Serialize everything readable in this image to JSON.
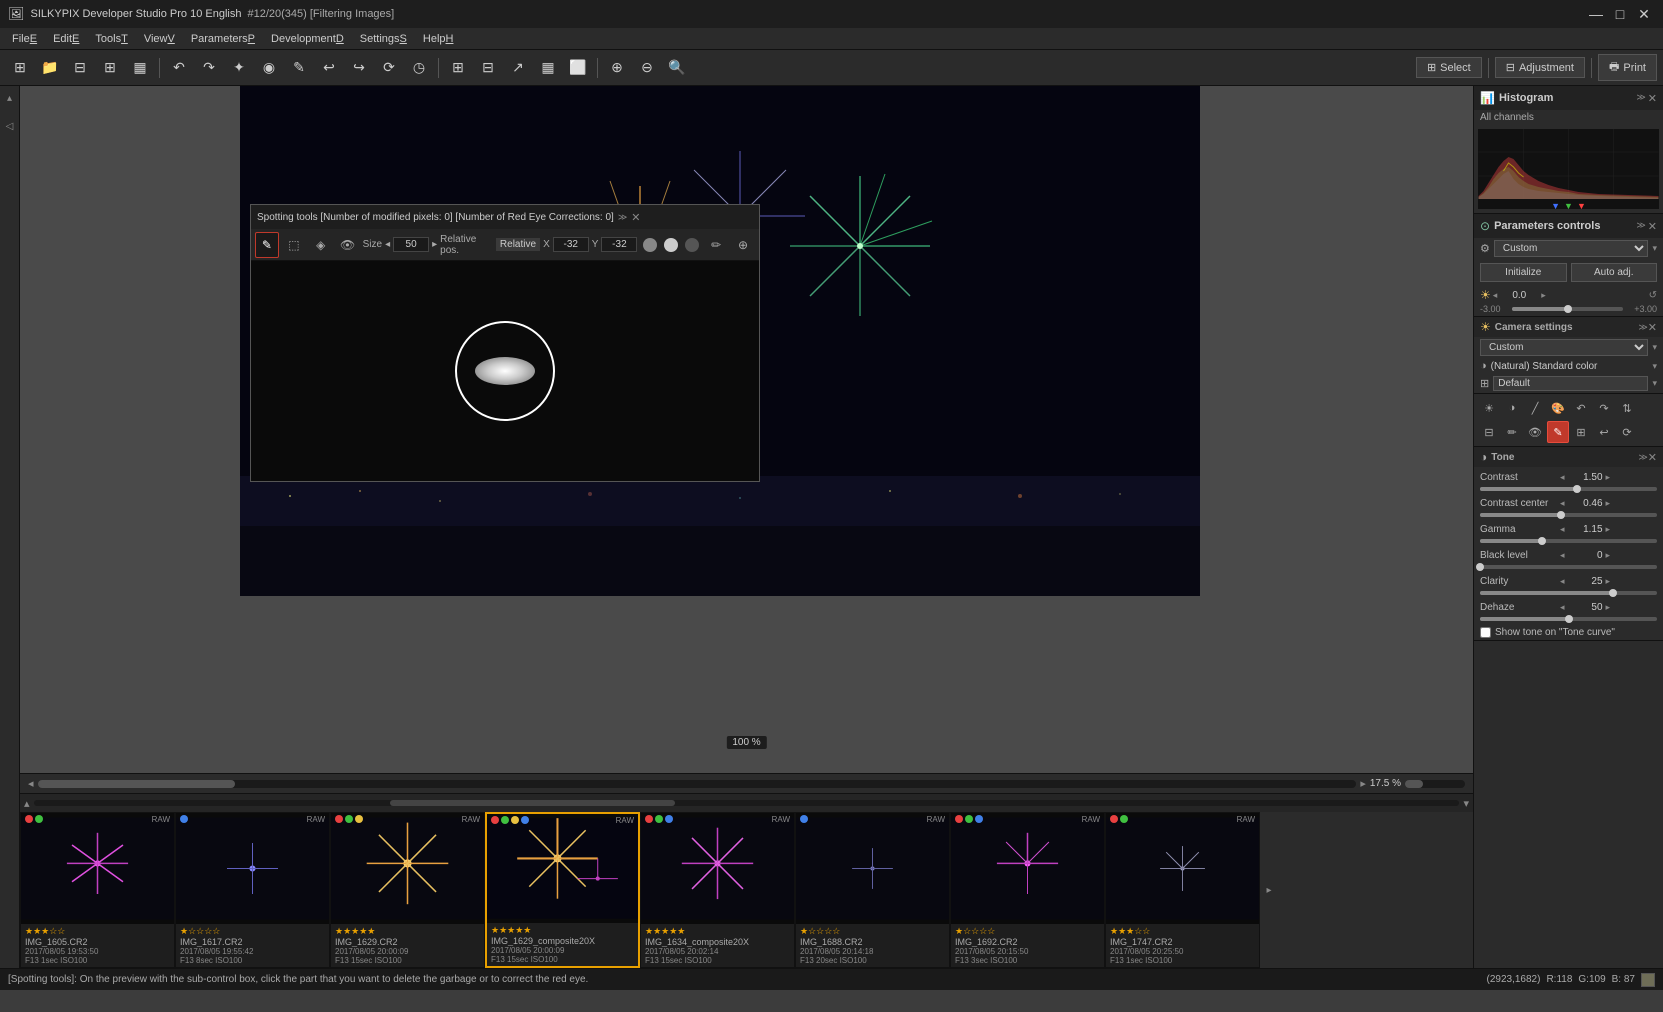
{
  "app": {
    "title": "SILKYPIX Developer Studio Pro 10 English",
    "subtitle": "#12/20(345) [Filtering Images]",
    "icon": "🖼"
  },
  "title_controls": {
    "minimize": "—",
    "maximize": "□",
    "close": "✕"
  },
  "menu": {
    "items": [
      {
        "label": "File(E)",
        "id": "file"
      },
      {
        "label": "Edit(E)",
        "id": "edit"
      },
      {
        "label": "Tools(T)",
        "id": "tools"
      },
      {
        "label": "View(V)",
        "id": "view"
      },
      {
        "label": "Parameters(P)",
        "id": "parameters"
      },
      {
        "label": "Development(D)",
        "id": "development"
      },
      {
        "label": "Settings(S)",
        "id": "settings"
      },
      {
        "label": "Help(H)",
        "id": "help"
      }
    ]
  },
  "toolbar": {
    "select_label": "Select",
    "select_icon": "⊞",
    "adjustment_label": "Adjustment",
    "adjustment_icon": "⊟",
    "print_label": "Print",
    "print_icon": "🖶"
  },
  "preview": {
    "zoom": "17.5",
    "zoom_unit": "%"
  },
  "spotting_tools": {
    "title": "Spotting tools [Number of modified pixels: 0] [Number of Red Eye Corrections: 0]",
    "size_label": "Size",
    "size_value": "50",
    "pos_label": "Relative pos.",
    "pos_type": "Relative",
    "x_label": "X",
    "x_value": "-32",
    "y_label": "Y",
    "y_value": "-32"
  },
  "histogram": {
    "title": "Histogram",
    "channel": "All channels"
  },
  "parameters_controls": {
    "title": "Parameters controls",
    "preset": "Custom",
    "initialize_label": "Initialize",
    "auto_adj_label": "Auto adj.",
    "value": "0.0",
    "range_min": "-3.00",
    "range_max": "+3.00"
  },
  "camera_settings": {
    "title": "Camera settings",
    "value": "Custom",
    "color_profile": "(Natural) Standard color"
  },
  "default_setting": {
    "label": "Default"
  },
  "tone": {
    "title": "Tone",
    "contrast_label": "Contrast",
    "contrast_value": "1.50",
    "contrast_center_label": "Contrast center",
    "contrast_center_value": "0.46",
    "gamma_label": "Gamma",
    "gamma_value": "1.15",
    "black_level_label": "Black level",
    "black_level_value": "0",
    "clarity_label": "Clarity",
    "clarity_value": "25",
    "dehaze_label": "Dehaze",
    "dehaze_value": "50",
    "tone_curve_label": "Show tone on \"Tone curve\""
  },
  "thumbnails": [
    {
      "name": "IMG_1605.CR2",
      "date": "2017/08/05 19:53:50",
      "settings": "F13 1sec ISO100",
      "stars": 3,
      "tags": [
        "red",
        "green"
      ],
      "raw": true,
      "selected": false,
      "color": "#c040c0"
    },
    {
      "name": "IMG_1617.CR2",
      "date": "2017/08/05 19:55:42",
      "settings": "F13 8sec ISO100",
      "stars": 1,
      "tags": [
        "blue"
      ],
      "raw": true,
      "selected": false,
      "color": "#8080a0"
    },
    {
      "name": "IMG_1629.CR2",
      "date": "2017/08/05 20:00:09",
      "settings": "F13 15sec ISO100",
      "stars": 5,
      "tags": [
        "red",
        "green",
        "yellow"
      ],
      "raw": true,
      "selected": false,
      "color": "#e8a000"
    },
    {
      "name": "IMG_1629_composite20X",
      "date": "2017/08/05 20:00:09",
      "settings": "F13 15sec ISO100",
      "stars": 5,
      "tags": [
        "red",
        "green",
        "yellow",
        "blue"
      ],
      "raw": true,
      "selected": true,
      "color": "#e8c060"
    },
    {
      "name": "IMG_1634_composite20X",
      "date": "2017/08/05 20:02:14",
      "settings": "F13 15sec ISO100",
      "stars": 5,
      "tags": [
        "red",
        "green",
        "blue"
      ],
      "raw": true,
      "selected": false,
      "color": "#e040e0"
    },
    {
      "name": "IMG_1688.CR2",
      "date": "2017/08/05 20:14:18",
      "settings": "F13 20sec ISO100",
      "stars": 1,
      "tags": [
        "blue"
      ],
      "raw": true,
      "selected": false,
      "color": "#6060c0"
    },
    {
      "name": "IMG_1692.CR2",
      "date": "2017/08/05 20:15:50",
      "settings": "F13 3sec ISO100",
      "stars": 1,
      "tags": [
        "red",
        "green",
        "blue"
      ],
      "raw": true,
      "selected": false,
      "color": "#c040c0"
    },
    {
      "name": "IMG_1747.CR2",
      "date": "2017/08/05 20:25:50",
      "settings": "F13 1sec ISO100",
      "stars": 3,
      "tags": [
        "red",
        "green"
      ],
      "raw": true,
      "selected": false,
      "color": "#a0a0c0"
    }
  ],
  "status": {
    "message": "[Spotting tools]: On the preview with the sub-control box, click the part that you want to delete the garbage or to correct the red eye.",
    "coords": "(2923,1682)",
    "r": "R:118",
    "g": "G:109",
    "b": "B: 87"
  },
  "icons": {
    "histogram_icon": "📊",
    "camera_icon": "📷",
    "wb_icon": "⚖",
    "tone_icon": "◑",
    "expand": "≫",
    "collapse": "≪",
    "pin": "📌",
    "close": "✕",
    "arrow_left": "◂",
    "arrow_right": "▸",
    "arrow_up": "▴",
    "arrow_down": "▾",
    "undo": "↶",
    "redo": "↷",
    "pencil": "✎",
    "eye": "👁",
    "brush": "🖌",
    "eraser": "◻"
  }
}
